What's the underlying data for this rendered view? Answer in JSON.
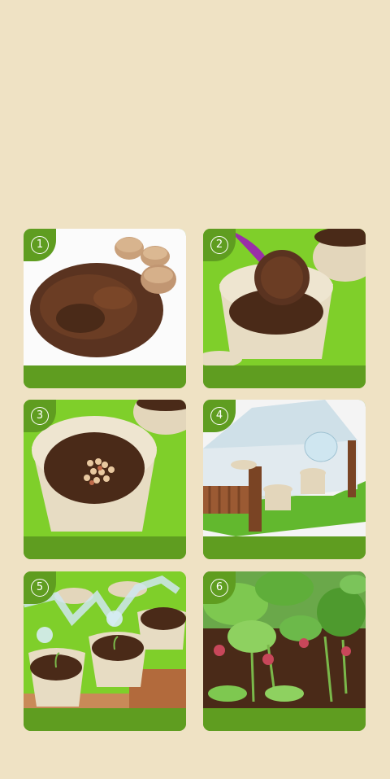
{
  "steps": [
    {
      "number": "1",
      "scene": "coco-soil"
    },
    {
      "number": "2",
      "scene": "scoop-soil-into-pot"
    },
    {
      "number": "3",
      "scene": "sow-seeds"
    },
    {
      "number": "4",
      "scene": "greenhouse-cover"
    },
    {
      "number": "5",
      "scene": "sprouting-seedlings"
    },
    {
      "number": "6",
      "scene": "grown-radishes"
    }
  ],
  "colors": {
    "background": "#efe2c4",
    "accent_green": "#5f9d20",
    "soil": "#4a2a18",
    "pot": "#e7dcc3",
    "tray_green": "#7fcf2a"
  }
}
